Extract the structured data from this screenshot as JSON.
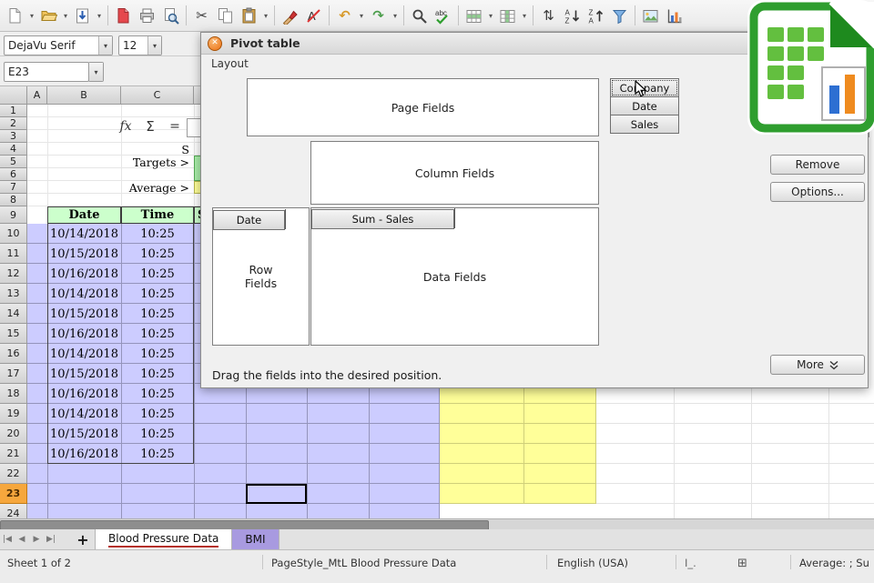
{
  "toolbar": {
    "items": [
      "new-document",
      "open",
      "save",
      "export-pdf",
      "print",
      "print-preview",
      "cut",
      "copy",
      "paste",
      "clone-formatting",
      "clear-formatting",
      "undo",
      "redo",
      "find-replace",
      "spelling",
      "insert-row",
      "insert-column",
      "sort",
      "sort-ascending",
      "sort-descending",
      "autofilter",
      "insert-image",
      "insert-chart"
    ]
  },
  "format_bar": {
    "font_name": "DejaVu Serif",
    "font_size": "12"
  },
  "formula_bar": {
    "cell_ref": "E23",
    "fx": "fx",
    "sum": "Σ",
    "equals": "="
  },
  "dialog": {
    "title": "Pivot table",
    "layout_label": "Layout",
    "areas": {
      "page": "Page Fields",
      "column": "Column Fields",
      "row": "Row\nFields",
      "data": "Data Fields"
    },
    "row_field": "Date",
    "data_field": "Sum - Sales",
    "available_fields": [
      "Company",
      "Date",
      "Sales"
    ],
    "buttons": {
      "remove": "Remove",
      "options": "Options...",
      "more": "More"
    },
    "hint": "Drag the fields into the desired position."
  },
  "sheet": {
    "col_headers": [
      "A",
      "B",
      "C"
    ],
    "row_numbers": [
      1,
      2,
      3,
      4,
      5,
      6,
      7,
      8,
      9,
      10,
      11,
      12,
      13,
      14,
      15,
      16,
      17,
      18,
      19,
      20,
      21,
      22,
      23,
      24
    ],
    "current_row": 23,
    "cells": {
      "c4": "S",
      "targets": "Targets >",
      "average": "Average >"
    },
    "table_header": {
      "date": "Date",
      "time": "Time",
      "partial": "S"
    },
    "data_rows": [
      {
        "date": "10/14/2018",
        "time": "10:25"
      },
      {
        "date": "10/15/2018",
        "time": "10:25"
      },
      {
        "date": "10/16/2018",
        "time": "10:25"
      },
      {
        "date": "10/14/2018",
        "time": "10:25"
      },
      {
        "date": "10/15/2018",
        "time": "10:25"
      },
      {
        "date": "10/16/2018",
        "time": "10:25"
      },
      {
        "date": "10/14/2018",
        "time": "10:25"
      },
      {
        "date": "10/15/2018",
        "time": "10:25"
      },
      {
        "date": "10/16/2018",
        "time": "10:25"
      },
      {
        "date": "10/14/2018",
        "time": "10:25"
      },
      {
        "date": "10/15/2018",
        "time": "10:25"
      },
      {
        "date": "10/16/2018",
        "time": "10:25"
      }
    ]
  },
  "tabs": {
    "nav": [
      "|◀",
      "◀",
      "▶",
      "▶|"
    ],
    "add": "+",
    "sheet_tabs": [
      {
        "label": "Blood Pressure Data",
        "active": true
      },
      {
        "label": "BMI",
        "active": false
      }
    ]
  },
  "status_bar": {
    "sheet_info": "Sheet 1 of 2",
    "page_style": "PageStyle_MtL Blood Pressure Data",
    "language": "English (USA)",
    "icons": [
      {
        "name": "insert-mode-icon",
        "glyph": "I_."
      },
      {
        "name": "outline-icon",
        "glyph": "⊞"
      }
    ],
    "summary": "Average: ; Su"
  },
  "colors": {
    "cell_blue": "#ccccff",
    "cell_yellow": "#ffff99",
    "header_green": "#ccffcc",
    "target_green": "#aaeeaa",
    "row_highlight": "#f6a73d",
    "tab_purple": "#a89ae0",
    "brand_green": "#2f9e2f"
  }
}
